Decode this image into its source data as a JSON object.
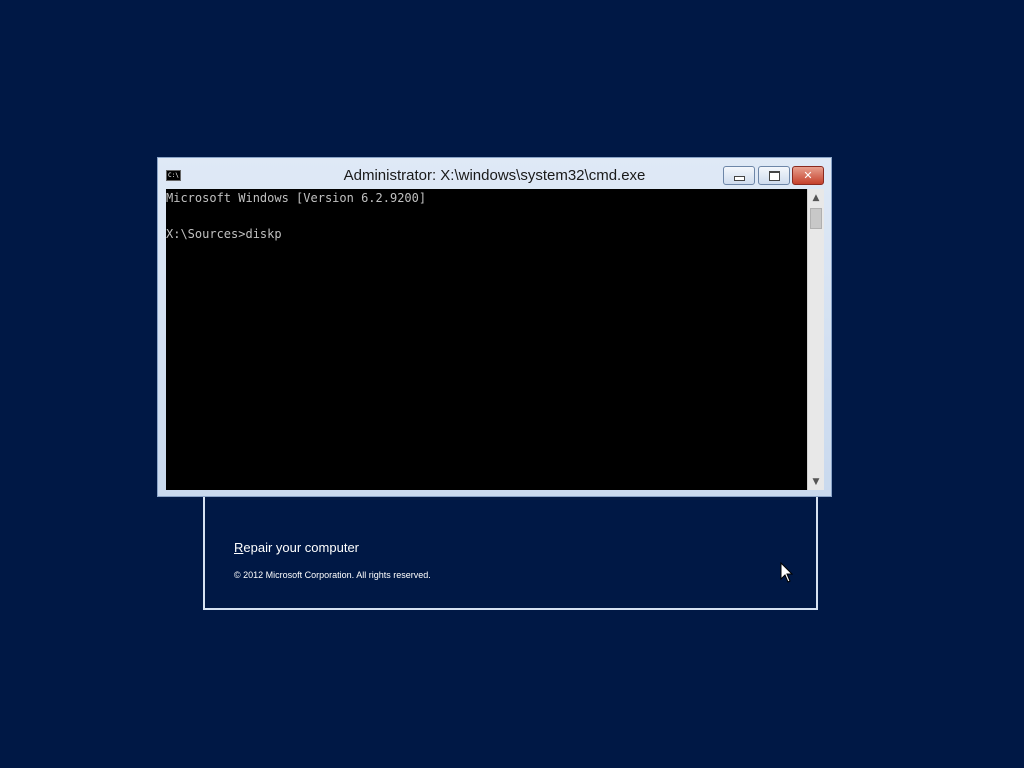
{
  "window": {
    "title": "Administrator: X:\\windows\\system32\\cmd.exe",
    "icon": "cmd-icon",
    "icon_label": "C:\\",
    "buttons": {
      "minimize": "minimize-icon",
      "maximize": "maximize-icon",
      "close": "✕"
    }
  },
  "console": {
    "lines": [
      "Microsoft Windows [Version 6.2.9200]",
      "",
      "X:\\Sources>diskp"
    ]
  },
  "setup": {
    "repair_first_letter": "R",
    "repair_rest": "epair your computer",
    "copyright": "© 2012 Microsoft Corporation. All rights reserved."
  },
  "scrollbar": {
    "up": "▲",
    "down": "▼"
  },
  "colors": {
    "desktop": "#001845",
    "console_bg": "#000000",
    "console_text": "#c0c0c0",
    "close_button": "#c4412c"
  }
}
